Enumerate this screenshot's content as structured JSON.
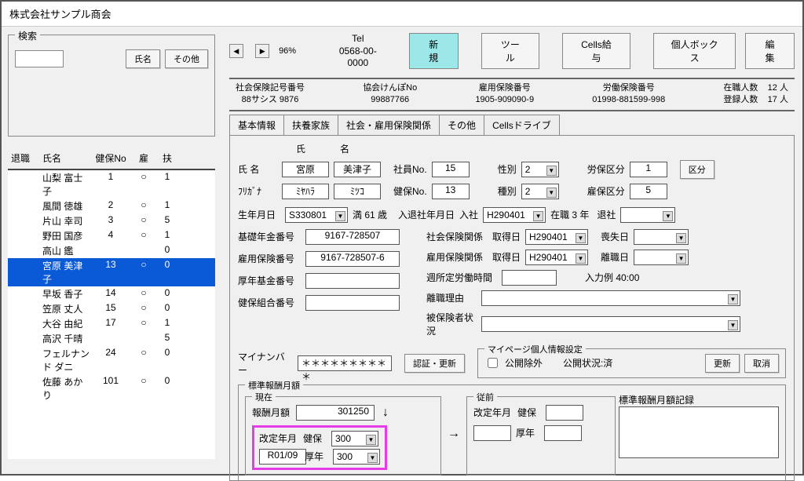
{
  "window_title": "株式会社サンプル商会",
  "search": {
    "legend": "検索",
    "name_btn": "氏名",
    "other_btn": "その他"
  },
  "top": {
    "zoom": "96%",
    "tel_label": "Tel",
    "tel_value": "0568-00-0000",
    "new_btn": "新規",
    "tool_btn": "ツール",
    "cells_btn": "Cells給与",
    "box_btn": "個人ボックス",
    "edit_btn": "編集"
  },
  "header": {
    "c1_label": "社会保険記号番号",
    "c1_value": "88サシス 9876",
    "c2_label": "協会けんぽNo",
    "c2_value": "99887766",
    "c3_label": "雇用保険番号",
    "c3_value": "1905-909090-9",
    "c4_label": "労働保険番号",
    "c4_value": "01998-881599-998",
    "r1_label": "在職人数",
    "r1_value": "12  人",
    "r2_label": "登録人数",
    "r2_value": "17  人"
  },
  "emp_header": {
    "c1": "退職",
    "c2": "氏名",
    "c3": "健保No",
    "c4": "雇",
    "c5": "扶"
  },
  "employees": [
    {
      "t": "",
      "name": "山梨 富士子",
      "no": "1",
      "k": "○",
      "f": "1"
    },
    {
      "t": "",
      "name": "風間 徳雄",
      "no": "2",
      "k": "○",
      "f": "1"
    },
    {
      "t": "",
      "name": "片山 幸司",
      "no": "3",
      "k": "○",
      "f": "5"
    },
    {
      "t": "",
      "name": "野田 国彦",
      "no": "4",
      "k": "○",
      "f": "1"
    },
    {
      "t": "",
      "name": "高山 鑑",
      "no": "",
      "k": "",
      "f": "0"
    },
    {
      "t": "",
      "name": "宮原 美津子",
      "no": "13",
      "k": "○",
      "f": "0",
      "selected": true
    },
    {
      "t": "",
      "name": "早坂 香子",
      "no": "14",
      "k": "○",
      "f": "0"
    },
    {
      "t": "",
      "name": "笠原 丈人",
      "no": "15",
      "k": "○",
      "f": "0"
    },
    {
      "t": "",
      "name": "大谷 由紀",
      "no": "17",
      "k": "○",
      "f": "1"
    },
    {
      "t": "",
      "name": "高沢 千晴",
      "no": "",
      "k": "",
      "f": "5"
    },
    {
      "t": "",
      "name": "フェルナンド ダニ",
      "no": "24",
      "k": "○",
      "f": "0"
    },
    {
      "t": "",
      "name": "佐藤 あかり",
      "no": "101",
      "k": "○",
      "f": "0"
    }
  ],
  "tabs": {
    "t1": "基本情報",
    "t2": "扶養家族",
    "t3": "社会・雇用保険関係",
    "t4": "その他",
    "t5": "Cellsドライブ"
  },
  "form": {
    "sei_lbl": "氏",
    "mei_lbl": "名",
    "name_lbl": "氏 名",
    "sei": "宮原",
    "mei": "美津子",
    "kana_lbl": "ﾌﾘｶﾞﾅ",
    "sei_kana": "ﾐﾔﾊﾗ",
    "mei_kana": "ﾐﾂｺ",
    "empno_lbl": "社員No.",
    "empno": "15",
    "kenpo_lbl": "健保No.",
    "kenpo": "13",
    "sex_lbl": "性別",
    "sex": "2",
    "type_lbl": "種別",
    "type": "2",
    "rohoku_lbl": "労保区分",
    "rohoku": "1",
    "koyoku_lbl": "雇保区分",
    "koyoku": "5",
    "kubun_btn": "区分",
    "birth_lbl": "生年月日",
    "birth": "S330801",
    "age_lbl": "満 61 歳",
    "joinleave_lbl": "入退社年月日",
    "join_lbl": "入社",
    "join": "H290401",
    "tenure": "在職  3  年",
    "leave_lbl": "退社",
    "pension_lbl": "基礎年金番号",
    "pension": "9167-728507",
    "empins_lbl": "雇用保険番号",
    "empins": "9167-728507-6",
    "konen_lbl": "厚年基金番号",
    "kenpokumiai_lbl": "健保組合番号",
    "shakai_lbl": "社会保険関係",
    "shakai_get": "取得日",
    "shakai_date": "H290401",
    "shakai_loss": "喪失日",
    "koyo_lbl": "雇用保険関係",
    "koyo_get": "取得日",
    "koyo_date": "H290401",
    "koyo_leave": "離職日",
    "weekly_lbl": "週所定労働時間",
    "weekly_ex": "入力例 40:00",
    "leave_reason_lbl": "離職理由",
    "insured_lbl": "被保険者状況",
    "mynum_lbl": "マイナンバー",
    "mynum": "＊＊＊＊＊＊＊＊＊＊",
    "auth_btn": "認証・更新",
    "mypage_legend": "マイページ個人情報設定",
    "exclude": "公開除外",
    "status": "公開状況:済",
    "update": "更新",
    "cancel": "取消",
    "std_legend": "標準報酬月額",
    "now": "現在",
    "prev": "従前",
    "record": "標準報酬月額記録",
    "monthly_lbl": "報酬月額",
    "monthly": "301250",
    "revdate_lbl": "改定年月",
    "kp": "健保",
    "kn": "厚年",
    "revdate": "R01/09",
    "kp_val": "300",
    "kn_val": "300"
  }
}
